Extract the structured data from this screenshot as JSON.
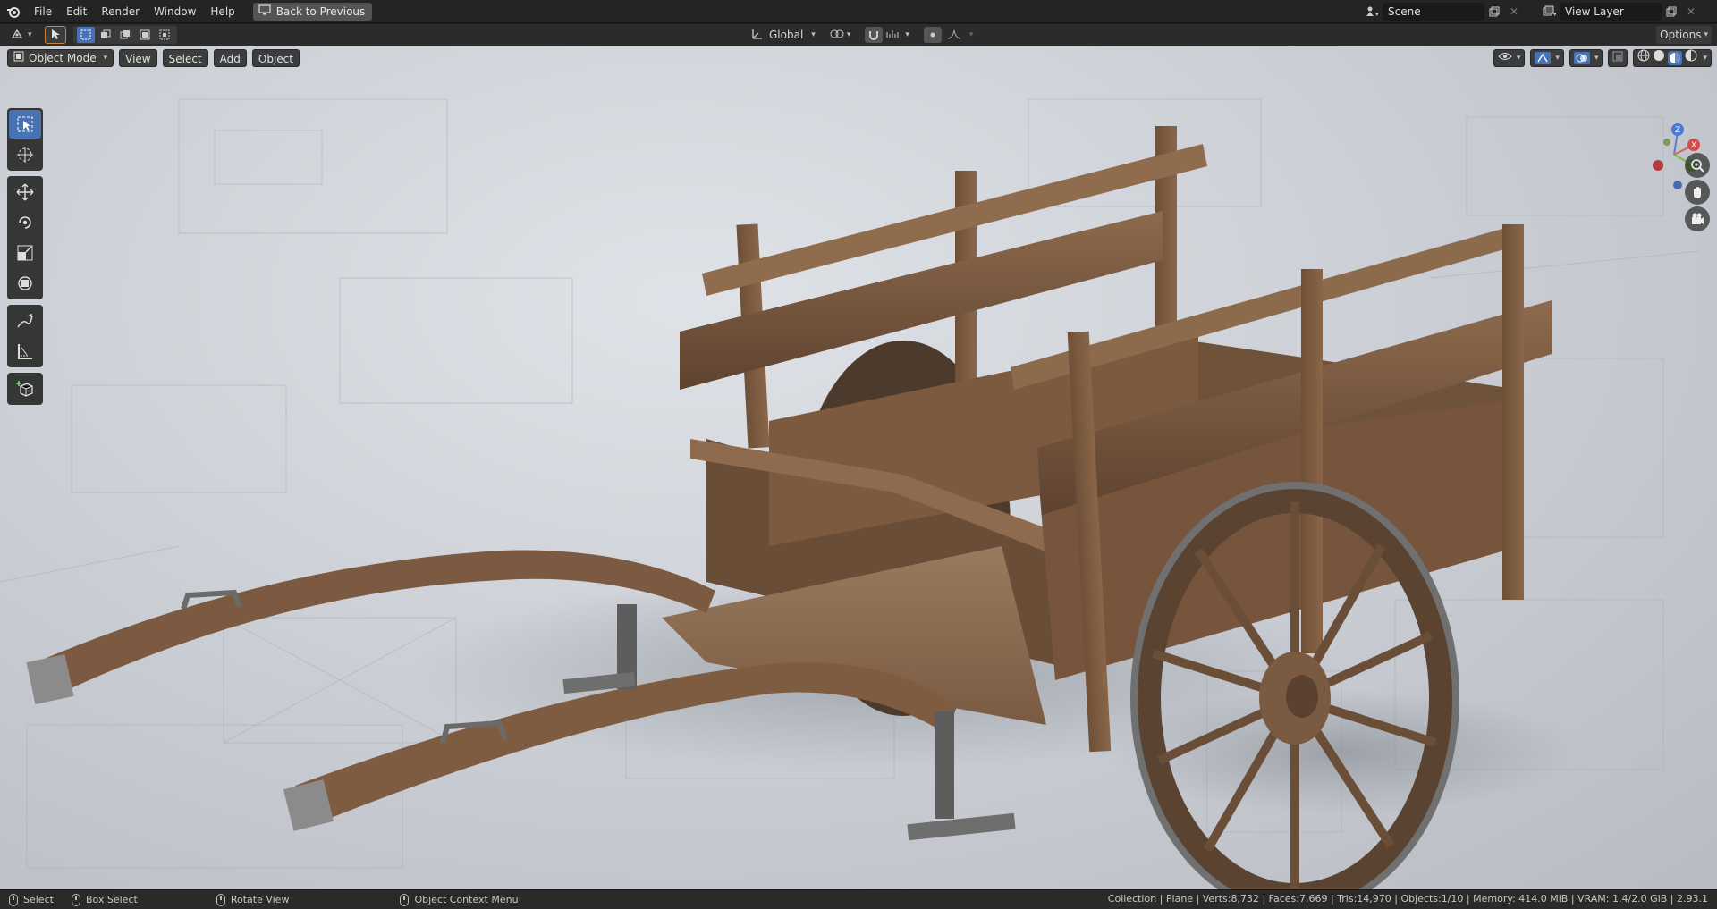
{
  "topbar": {
    "menus": [
      "File",
      "Edit",
      "Render",
      "Window",
      "Help"
    ],
    "back_label": "Back to Previous",
    "scene_value": "Scene",
    "view_layer_value": "View Layer"
  },
  "toolrow": {
    "orientation_value": "Global",
    "options_label": "Options"
  },
  "viewport_header": {
    "mode_label": "Object Mode",
    "menu_view": "View",
    "menu_select": "Select",
    "menu_add": "Add",
    "menu_object": "Object"
  },
  "gizmo": {
    "z_label": "Z",
    "y_label": "Y",
    "x_label": "X"
  },
  "statusbar": {
    "select_label": "Select",
    "box_select_label": "Box Select",
    "rotate_view_label": "Rotate View",
    "context_menu_label": "Object Context Menu",
    "stats": "Collection | Plane | Verts:8,732 | Faces:7,669 | Tris:14,970 | Objects:1/10 | Memory: 414.0 MiB | VRAM: 1.4/2.0 GiB | 2.93.1"
  },
  "colors": {
    "active_tool": "#4772b3",
    "wood_dark": "#5e4330",
    "wood_mid": "#7d5a40",
    "wood_light": "#9a7558",
    "metal": "#8a8a8a"
  }
}
